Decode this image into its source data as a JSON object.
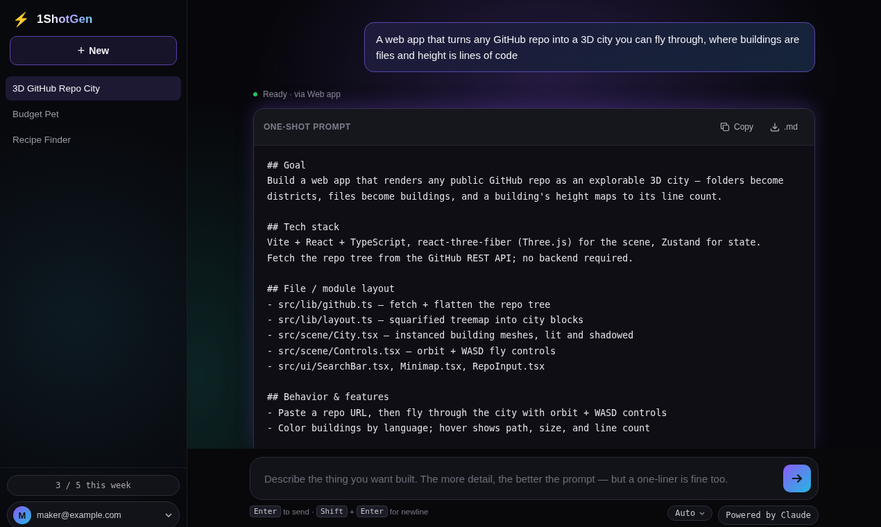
{
  "sidebar": {
    "brand": {
      "icon": "⚡",
      "name": "1ShotGen"
    },
    "new_button": {
      "icon": "+",
      "label": "New"
    },
    "items": [
      {
        "label": "3D GitHub Repo City",
        "selected": true
      },
      {
        "label": "Budget Pet",
        "selected": false
      },
      {
        "label": "Recipe Finder",
        "selected": false
      }
    ],
    "usage": "3 / 5 this week",
    "account": {
      "initial": "M",
      "email": "maker@example.com"
    }
  },
  "conversation": {
    "user_message": "A web app that turns any GitHub repo into a 3D city you can fly through, where buildings are files and height is lines of code",
    "status": {
      "text": "Ready · via Web app",
      "color": "#22c55e"
    },
    "prompt_card": {
      "title": "ONE-SHOT PROMPT",
      "actions": [
        {
          "kind": "copy",
          "label": "Copy"
        },
        {
          "kind": "download",
          "label": ".md"
        }
      ],
      "sections": [
        {
          "lines": [
            "## Goal",
            "Build a web app that renders any public GitHub repo as an explorable 3D city — folders become",
            "districts, files become buildings, and a building's height maps to its line count."
          ]
        },
        {
          "lines": [
            "## Tech stack",
            "Vite + React + TypeScript, react-three-fiber (Three.js) for the scene, Zustand for state.",
            "Fetch the repo tree from the GitHub REST API; no backend required."
          ]
        },
        {
          "lines": [
            "## File / module layout",
            "- src/lib/github.ts — fetch + flatten the repo tree",
            "- src/lib/layout.ts — squarified treemap into city blocks",
            "- src/scene/City.tsx — instanced building meshes, lit and shadowed",
            "- src/scene/Controls.tsx — orbit + WASD fly controls",
            "- src/ui/SearchBar.tsx, Minimap.tsx, RepoInput.tsx"
          ]
        },
        {
          "lines": [
            "## Behavior & features",
            "- Paste a repo URL, then fly through the city with orbit + WASD controls",
            "- Color buildings by language; hover shows path, size, and line count"
          ]
        }
      ]
    }
  },
  "composer": {
    "placeholder": "Describe the thing you want built. The more detail, the better the prompt — but a one-liner is fine too.",
    "hint": [
      {
        "kind": "key",
        "text": "Enter"
      },
      {
        "kind": "text",
        "text": "to send ·"
      },
      {
        "kind": "key",
        "text": "Shift"
      },
      {
        "kind": "text",
        "text": "+"
      },
      {
        "kind": "key",
        "text": "Enter"
      },
      {
        "kind": "text",
        "text": "for newline"
      }
    ],
    "model": "Auto",
    "powered_by": "Powered by Claude"
  }
}
